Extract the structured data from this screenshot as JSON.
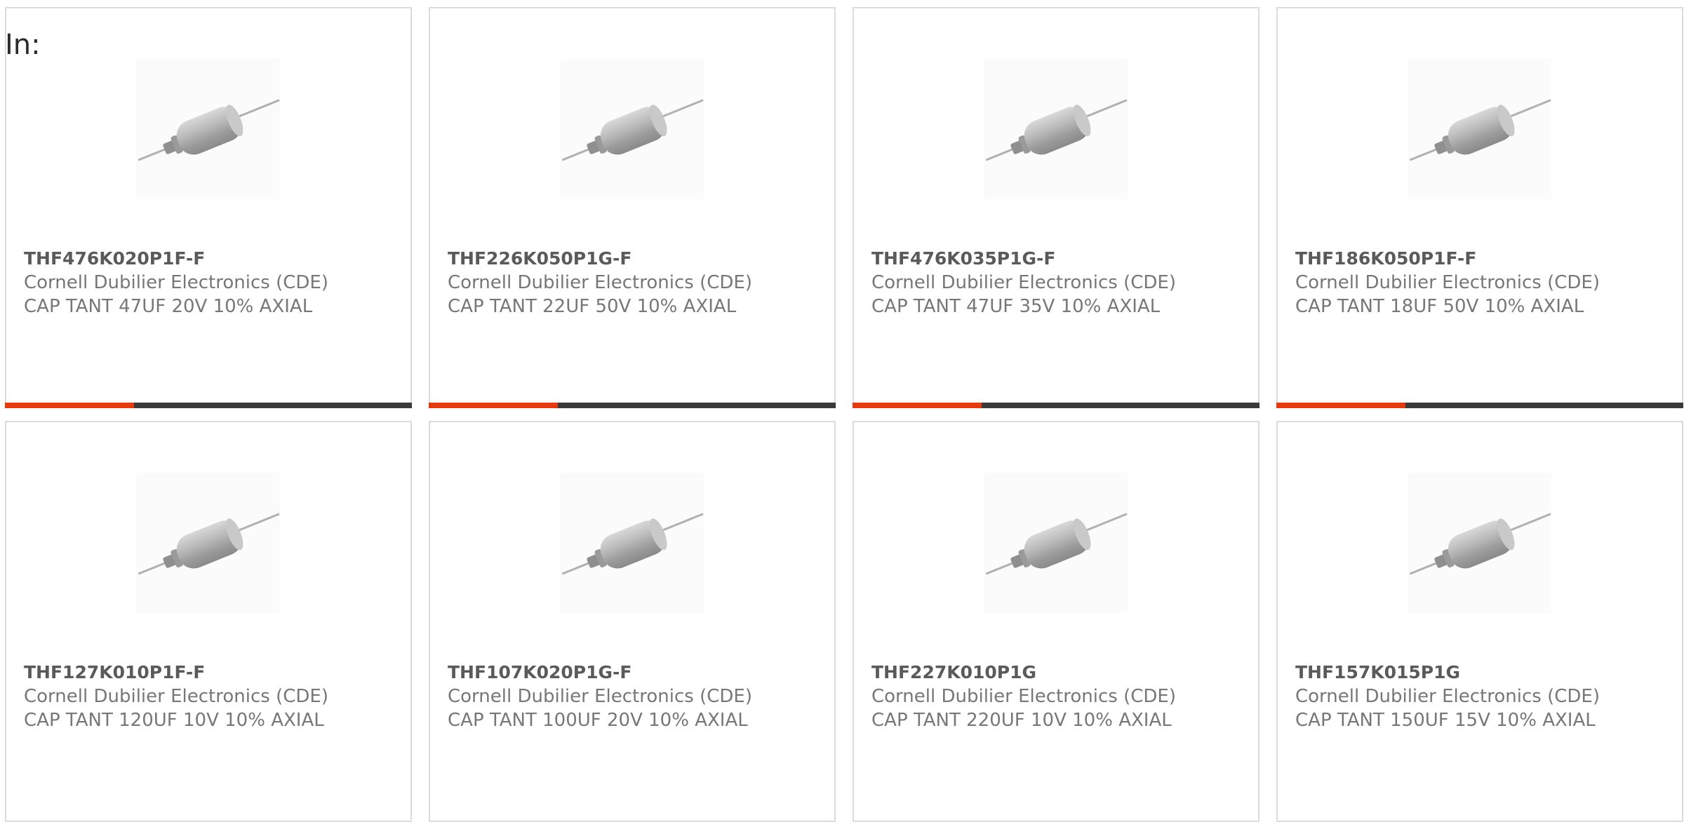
{
  "header": {
    "in_label": "In:"
  },
  "products": [
    {
      "part_number": "THF476K020P1F-F",
      "manufacturer": "Cornell Dubilier Electronics (CDE)",
      "description": "CAP TANT 47UF 20V 10% AXIAL",
      "image_icon": "axial-capacitor-icon",
      "has_progress_bar": true
    },
    {
      "part_number": "THF226K050P1G-F",
      "manufacturer": "Cornell Dubilier Electronics (CDE)",
      "description": "CAP TANT 22UF 50V 10% AXIAL",
      "image_icon": "axial-capacitor-icon",
      "has_progress_bar": true
    },
    {
      "part_number": "THF476K035P1G-F",
      "manufacturer": "Cornell Dubilier Electronics (CDE)",
      "description": "CAP TANT 47UF 35V 10% AXIAL",
      "image_icon": "axial-capacitor-icon",
      "has_progress_bar": true
    },
    {
      "part_number": "THF186K050P1F-F",
      "manufacturer": "Cornell Dubilier Electronics (CDE)",
      "description": "CAP TANT 18UF 50V 10% AXIAL",
      "image_icon": "axial-capacitor-icon",
      "has_progress_bar": true
    },
    {
      "part_number": "THF127K010P1F-F",
      "manufacturer": "Cornell Dubilier Electronics (CDE)",
      "description": "CAP TANT 120UF 10V 10% AXIAL",
      "image_icon": "axial-capacitor-icon",
      "has_progress_bar": false
    },
    {
      "part_number": "THF107K020P1G-F",
      "manufacturer": "Cornell Dubilier Electronics (CDE)",
      "description": "CAP TANT 100UF 20V 10% AXIAL",
      "image_icon": "axial-capacitor-icon",
      "has_progress_bar": false
    },
    {
      "part_number": "THF227K010P1G",
      "manufacturer": "Cornell Dubilier Electronics (CDE)",
      "description": "CAP TANT 220UF 10V 10% AXIAL",
      "image_icon": "axial-capacitor-icon",
      "has_progress_bar": false
    },
    {
      "part_number": "THF157K015P1G",
      "manufacturer": "Cornell Dubilier Electronics (CDE)",
      "description": "CAP TANT 150UF 15V 10% AXIAL",
      "image_icon": "axial-capacitor-icon",
      "has_progress_bar": false
    }
  ],
  "colors": {
    "accent": "#e23b12",
    "bar_dark": "#3a3a3a",
    "card_border": "#dcdcdc",
    "part_text": "#5a5a5a",
    "secondary_text": "#777777"
  }
}
